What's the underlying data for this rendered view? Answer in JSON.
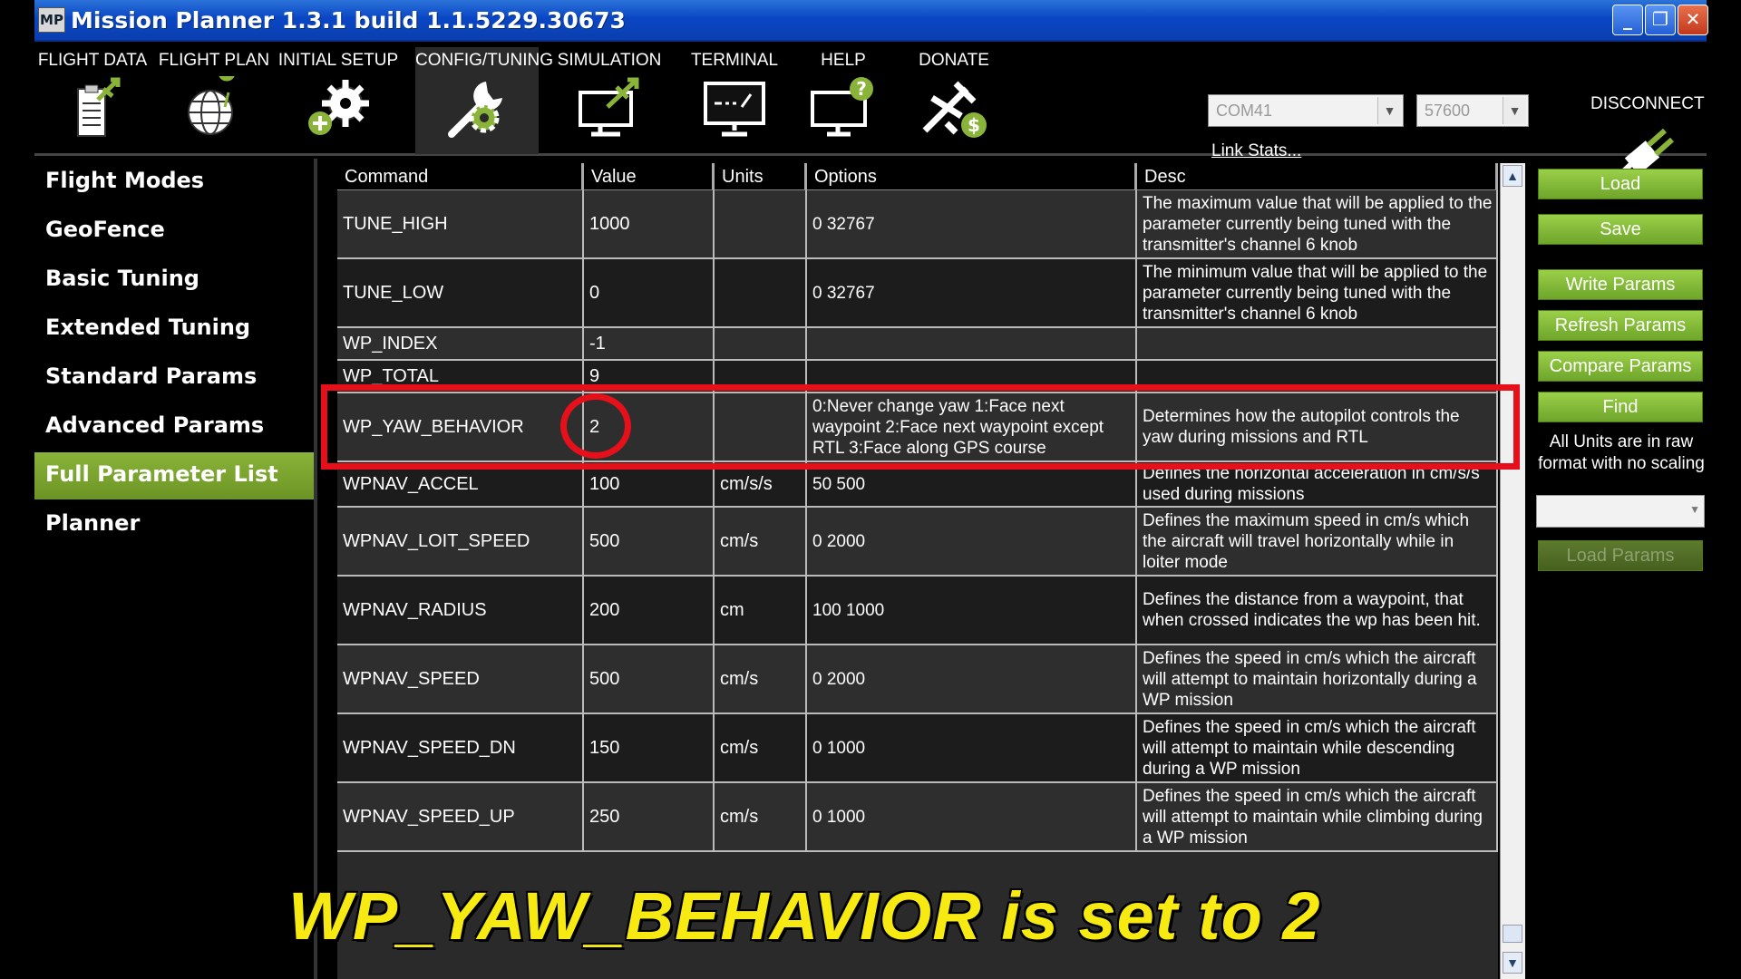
{
  "window": {
    "app_icon_text": "MP",
    "title": "Mission Planner 1.3.1 build 1.1.5229.30673",
    "buttons": {
      "minimize": "_",
      "maximize": "❐",
      "close": "✕"
    }
  },
  "toolbar": {
    "menu": [
      {
        "label": "FLIGHT DATA",
        "icon": "clipboard-plane-icon"
      },
      {
        "label": "FLIGHT PLAN",
        "icon": "globe-icon"
      },
      {
        "label": "INITIAL SETUP",
        "icon": "gears-icon"
      },
      {
        "label": "CONFIG/TUNING",
        "icon": "wrench-gear-icon",
        "active": true
      },
      {
        "label": "SIMULATION",
        "icon": "monitor-plane-icon"
      },
      {
        "label": "TERMINAL",
        "icon": "monitor-terminal-icon"
      },
      {
        "label": "HELP",
        "icon": "monitor-help-icon"
      },
      {
        "label": "DONATE",
        "icon": "plane-dollar-icon"
      }
    ],
    "port": "COM41",
    "baud": "57600",
    "link_stats": "Link Stats...",
    "disconnect": "DISCONNECT"
  },
  "sidebar": {
    "items": [
      {
        "label": "Flight Modes"
      },
      {
        "label": "GeoFence"
      },
      {
        "label": "Basic Tuning"
      },
      {
        "label": "Extended Tuning"
      },
      {
        "label": "Standard Params"
      },
      {
        "label": "Advanced Params"
      },
      {
        "label": "Full Parameter List",
        "active": true
      },
      {
        "label": "Planner"
      }
    ]
  },
  "params_table": {
    "headers": {
      "command": "Command",
      "value": "Value",
      "units": "Units",
      "options": "Options",
      "desc": "Desc"
    },
    "rows": [
      {
        "command": "TUNE_HIGH",
        "value": "1000",
        "units": "",
        "options": "0 32767",
        "desc": "The maximum value that will be applied to the parameter currently being tuned with the transmitter's channel 6 knob"
      },
      {
        "command": "TUNE_LOW",
        "value": "0",
        "units": "",
        "options": "0 32767",
        "desc": "The minimum value that will be applied to the parameter currently being tuned with the transmitter's channel 6 knob"
      },
      {
        "command": "WP_INDEX",
        "value": "-1",
        "units": "",
        "options": "",
        "desc": ""
      },
      {
        "command": "WP_TOTAL",
        "value": "9",
        "units": "",
        "options": "",
        "desc": ""
      },
      {
        "command": "WP_YAW_BEHAVIOR",
        "value": "2",
        "units": "",
        "options": "0:Never change yaw  1:Face next waypoint  2:Face next waypoint except RTL  3:Face along GPS course",
        "desc": "Determines how the autopilot controls the yaw during missions and RTL"
      },
      {
        "command": "WPNAV_ACCEL",
        "value": "100",
        "units": "cm/s/s",
        "options": "50 500",
        "desc": "Defines the horizontal acceleration in cm/s/s used during missions"
      },
      {
        "command": "WPNAV_LOIT_SPEED",
        "value": "500",
        "units": "cm/s",
        "options": "0 2000",
        "desc": "Defines the maximum speed in cm/s which the aircraft will travel horizontally while in loiter mode"
      },
      {
        "command": "WPNAV_RADIUS",
        "value": "200",
        "units": "cm",
        "options": "100 1000",
        "desc": "Defines the distance from a waypoint, that when crossed indicates the wp has been hit."
      },
      {
        "command": "WPNAV_SPEED",
        "value": "500",
        "units": "cm/s",
        "options": "0 2000",
        "desc": "Defines the speed in cm/s which the aircraft will attempt to maintain horizontally during a WP mission"
      },
      {
        "command": "WPNAV_SPEED_DN",
        "value": "150",
        "units": "cm/s",
        "options": "0 1000",
        "desc": "Defines the speed in cm/s which the aircraft will attempt to maintain while descending during a WP mission"
      },
      {
        "command": "WPNAV_SPEED_UP",
        "value": "250",
        "units": "cm/s",
        "options": "0 1000",
        "desc": "Defines the speed in cm/s which the aircraft will attempt to maintain while climbing during a WP mission"
      }
    ]
  },
  "right_panel": {
    "load": "Load",
    "save": "Save",
    "write_params": "Write Params",
    "refresh_params": "Refresh Params",
    "compare_params": "Compare Params",
    "find": "Find",
    "units_note": "All Units are in raw format with no scaling",
    "load_params": "Load Params"
  },
  "caption": "WP_YAW_BEHAVIOR is set to 2",
  "colors": {
    "accent_green": "#8ab33a",
    "highlight_red": "#e5101a",
    "caption_yellow": "#f7ea13",
    "titlebar_blue": "#0a46c4"
  }
}
